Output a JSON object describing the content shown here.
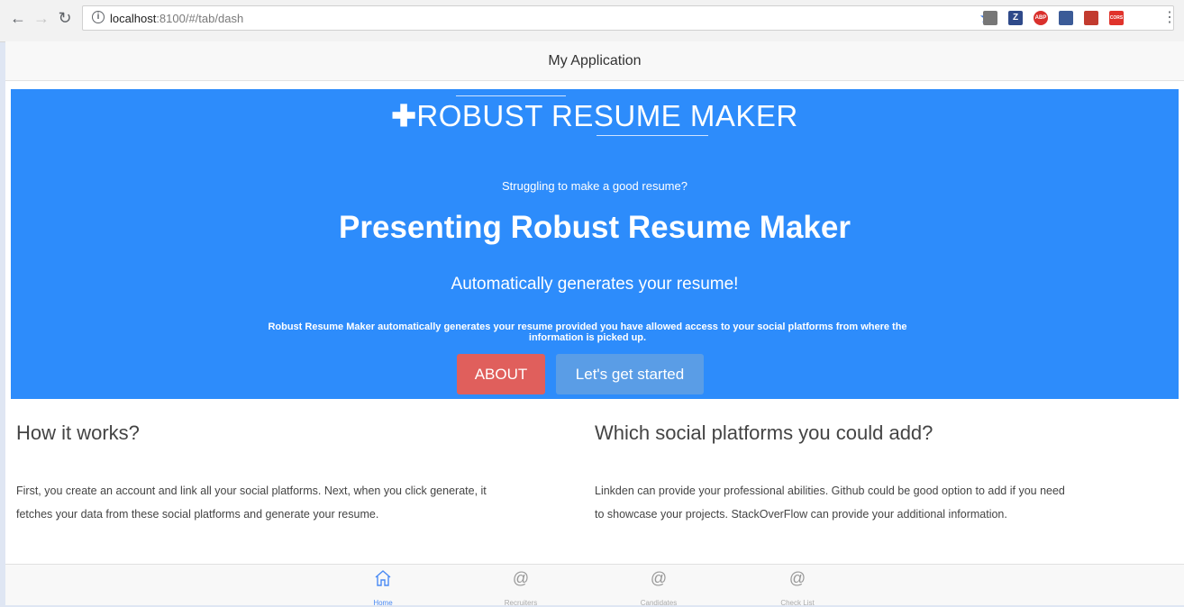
{
  "browser": {
    "url_host": "localhost",
    "url_rest": ":8100/#/tab/dash",
    "extensions": [
      {
        "name": "pocket-icon",
        "label": "",
        "color": "#777777"
      },
      {
        "name": "zotero-icon",
        "label": "Z",
        "color": "#2f4a8a"
      },
      {
        "name": "abp-icon",
        "label": "ABP",
        "color": "#d9302c"
      },
      {
        "name": "people-icon",
        "label": "",
        "color": "#3b5b97"
      },
      {
        "name": "bookmark-red-icon",
        "label": "",
        "color": "#c23b2f"
      },
      {
        "name": "cors-icon",
        "label": "CORS",
        "color": "#e0332b"
      }
    ]
  },
  "app": {
    "title": "My Application"
  },
  "hero": {
    "brand": "ROBUST RESUME MAKER",
    "tagline": "Struggling to make a good resume?",
    "headline": "Presenting Robust Resume Maker",
    "subheadline": "Automatically generates your resume!",
    "description": "Robust Resume Maker automatically generates your resume provided you have allowed access to your social platforms from where the information is picked up.",
    "about_label": "ABOUT",
    "start_label": "Let's get started",
    "color": "#2d8cfb"
  },
  "sections": {
    "how": {
      "title": "How it works?",
      "line1": "First, you create an account and link all your social platforms. Next, when you click generate, it",
      "line2": "fetches your data from these social platforms and generate your resume."
    },
    "platforms": {
      "title": "Which social platforms you could add?",
      "line1": "Linkden can provide your professional abilities. Github could be good option to add if you need",
      "line2": "to showcase your projects. StackOverFlow can provide your additional information."
    }
  },
  "tabs": [
    {
      "label": "Home",
      "active": true
    },
    {
      "label": "Recruiters",
      "active": false
    },
    {
      "label": "Candidates",
      "active": false
    },
    {
      "label": "Check List",
      "active": false
    }
  ]
}
